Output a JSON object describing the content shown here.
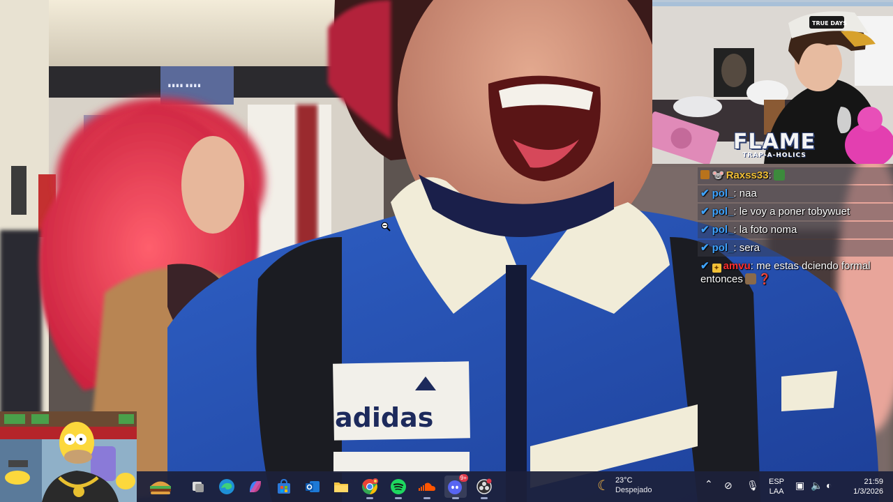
{
  "webcam": {
    "brand_title": "FLAME",
    "brand_subtitle": "TRAP-A-HOLICS",
    "cap_text": "TRUE DAYS"
  },
  "chat": {
    "messages": [
      {
        "user": "Raxss33",
        "text": "",
        "user_color": "#f2c037",
        "badge": "sub",
        "emote": true
      },
      {
        "user": "pol_",
        "text": "naa",
        "user_color": "#3ea3ff",
        "badge": "check"
      },
      {
        "user": "pol_",
        "text": "le voy a poner tobywuet",
        "user_color": "#3ea3ff",
        "badge": "check"
      },
      {
        "user": "pol_",
        "text": "la foto noma",
        "user_color": "#3ea3ff",
        "badge": "check"
      },
      {
        "user": "pol_",
        "text": "sera",
        "user_color": "#3ea3ff",
        "badge": "check"
      },
      {
        "user": "amvu",
        "text": "me estas dciendo formal entonces",
        "user_color": "#ff3030",
        "badge": "check-box"
      }
    ]
  },
  "background": {
    "jacket_logo": "adidas",
    "sign_text": "∎∎∎∎ ∎∎∎∎"
  },
  "taskbar": {
    "apps": [
      {
        "name": "widgets",
        "icon": "burger-widget-icon"
      },
      {
        "name": "task-view",
        "icon": "task-view-icon"
      },
      {
        "name": "edge",
        "icon": "edge-icon"
      },
      {
        "name": "copilot",
        "icon": "copilot-icon"
      },
      {
        "name": "store",
        "icon": "store-icon"
      },
      {
        "name": "outlook",
        "icon": "outlook-icon"
      },
      {
        "name": "file-explorer",
        "icon": "folder-icon"
      },
      {
        "name": "chrome",
        "icon": "chrome-icon"
      },
      {
        "name": "spotify",
        "icon": "spotify-icon"
      },
      {
        "name": "soundcloud",
        "icon": "soundcloud-icon"
      },
      {
        "name": "discord",
        "icon": "discord-icon",
        "badge": "9+"
      },
      {
        "name": "obs",
        "icon": "obs-icon"
      }
    ],
    "weather": {
      "temp": "23°C",
      "desc": "Despejado"
    },
    "language": {
      "line1": "ESP",
      "line2": "LAA"
    },
    "clock": {
      "time": "21:59",
      "date": "1/3/2026"
    },
    "colors": {
      "discord": "#5865f2",
      "spotify": "#1ed760",
      "soundcloud": "#ff5500",
      "chrome_red": "#ea4335",
      "chrome_yellow": "#fbbc05",
      "chrome_green": "#34a853",
      "chrome_blue": "#4285f4"
    }
  }
}
